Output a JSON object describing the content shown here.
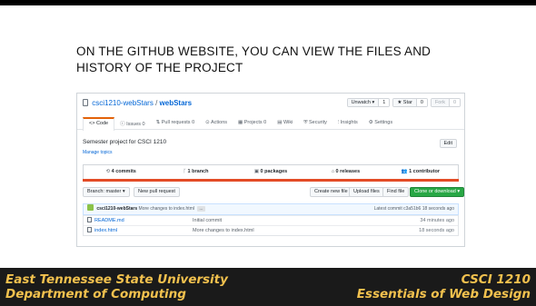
{
  "slide": {
    "title": "ON THE GITHUB WEBSITE, YOU CAN VIEW THE FILES AND HISTORY OF THE PROJECT"
  },
  "repo": {
    "owner": "csci1210-webStars",
    "name": "webStars",
    "separator": "/",
    "unwatch_label": "Unwatch ▾",
    "unwatch_count": "1",
    "star_label": "★ Star",
    "star_count": "0",
    "fork_label": "Fork",
    "fork_count": "0",
    "tabs": [
      {
        "label": "<> Code"
      },
      {
        "label": "ⓘ Issues 0"
      },
      {
        "label": "⇅ Pull requests 0"
      },
      {
        "label": "⊙ Actions"
      },
      {
        "label": "▦ Projects 0"
      },
      {
        "label": "▤ Wiki"
      },
      {
        "label": "⛨ Security"
      },
      {
        "label": "⫶ Insights"
      },
      {
        "label": "⚙ Settings"
      }
    ],
    "description": "Semester project for CSCI 1210",
    "manage_topics": "Manage topics",
    "edit_label": "Edit",
    "stats": {
      "commits": "4 commits",
      "branch": "1 branch",
      "packages": "0 packages",
      "releases": "0 releases",
      "contributor": "1 contributor"
    },
    "lang_color": "#e34c26",
    "branch_label": "Branch: master ▾",
    "new_pr_label": "New pull request",
    "create_file_label": "Create new file",
    "upload_label": "Upload files",
    "find_label": "Find file",
    "clone_label": "Clone or download ▾",
    "latest_commit": {
      "author": "csci1210-webStars",
      "message": "More changes to index.html",
      "ellipsis": "...",
      "summary": "Latest commit c3a51b6 18 seconds ago"
    },
    "files": [
      {
        "name": "README.md",
        "message": "Initial commit",
        "age": "34 minutes ago"
      },
      {
        "name": "index.html",
        "message": "More changes to index.html",
        "age": "18 seconds ago"
      }
    ]
  },
  "footer": {
    "university": "East Tennessee State University",
    "department": "Department of Computing",
    "course": "CSCI 1210",
    "course_name": "Essentials of Web Design"
  }
}
